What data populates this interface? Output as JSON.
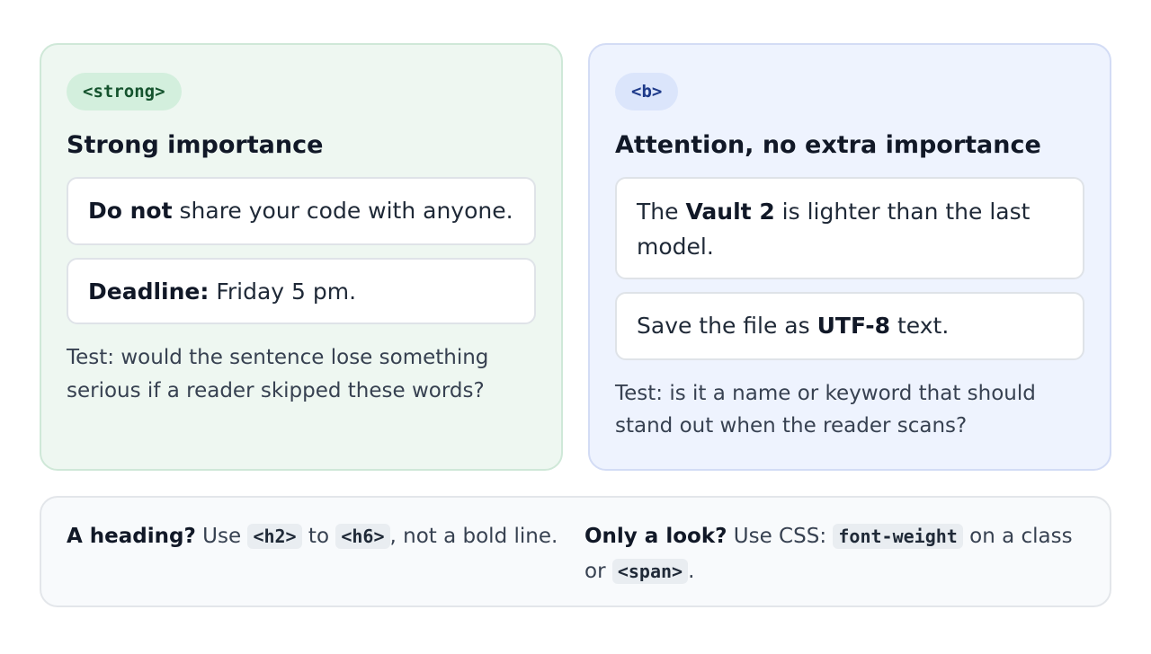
{
  "strong_card": {
    "tag": "<strong>",
    "title": "Strong importance",
    "example1": {
      "bold": "Do not",
      "rest": " share your code with anyone."
    },
    "example2": {
      "bold": "Deadline:",
      "rest": " Friday 5 pm."
    },
    "test": "Test: would the sentence lose something serious if a reader skipped these words?"
  },
  "b_card": {
    "tag": "<b>",
    "title": "Attention, no extra importance",
    "example1": {
      "before": "The ",
      "bold": "Vault 2",
      "after": " is lighter than the last model."
    },
    "example2": {
      "before": "Save the file as ",
      "bold": "UTF-8",
      "after": " text."
    },
    "test": "Test: is it a name or keyword that should stand out when the reader scans?"
  },
  "tips": {
    "left": {
      "bold": "A heading?",
      "text1": " Use ",
      "code1": "<h2>",
      "text2": " to ",
      "code2": "<h6>",
      "text3": ", not a bold line."
    },
    "right": {
      "bold": "Only a look?",
      "text1": " Use CSS: ",
      "code1": "font-weight",
      "text2": " on a class or ",
      "code2": "<span>",
      "text3": "."
    }
  },
  "colors": {
    "strong_bg": "#eef7f1",
    "strong_pill": "#d3efdd",
    "b_bg": "#eef3fe",
    "b_pill": "#dbe5fb",
    "tip_bg": "#f8fafc"
  }
}
